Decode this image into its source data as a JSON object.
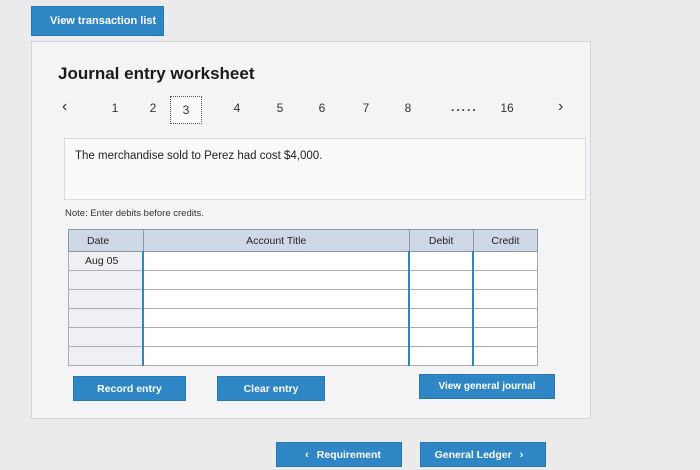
{
  "header": {
    "view_list_label": "View transaction list"
  },
  "worksheet": {
    "title": "Journal entry worksheet",
    "pager": {
      "pages": [
        "1",
        "2",
        "3",
        "4",
        "5",
        "6",
        "7",
        "8"
      ],
      "selected": "3",
      "ellipsis": ".....",
      "last": "16"
    },
    "description": "The merchandise sold to Perez had cost $4,000.",
    "note": "Note: Enter debits before credits.",
    "table": {
      "headers": {
        "date": "Date",
        "account": "Account Title",
        "debit": "Debit",
        "credit": "Credit"
      },
      "rows": [
        {
          "date": "Aug 05"
        },
        {
          "date": ""
        },
        {
          "date": ""
        },
        {
          "date": ""
        },
        {
          "date": ""
        },
        {
          "date": ""
        }
      ]
    },
    "buttons": {
      "record": "Record entry",
      "clear": "Clear entry",
      "view_journal": "View general journal"
    }
  },
  "footer": {
    "requirement_label": "Requirement",
    "ledger_label": "General Ledger"
  },
  "colors": {
    "accent": "#2f86c5",
    "header_bg": "#cfd8e6"
  }
}
